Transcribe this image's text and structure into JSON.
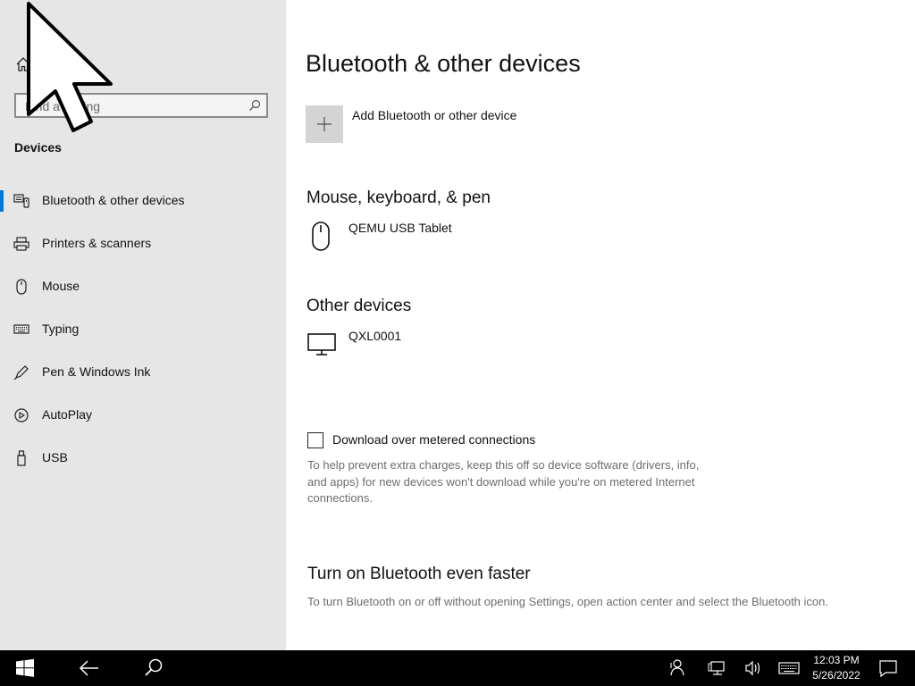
{
  "sidebar": {
    "home_icon": "home-icon",
    "search": {
      "placeholder": "Find a setting",
      "icon": "search-icon"
    },
    "section_title": "Devices",
    "items": [
      {
        "label": "Bluetooth & other devices",
        "icon": "bluetooth-devices-icon",
        "active": true
      },
      {
        "label": "Printers & scanners",
        "icon": "printer-icon"
      },
      {
        "label": "Mouse",
        "icon": "mouse-icon"
      },
      {
        "label": "Typing",
        "icon": "keyboard-icon"
      },
      {
        "label": "Pen & Windows Ink",
        "icon": "pen-icon"
      },
      {
        "label": "AutoPlay",
        "icon": "autoplay-icon"
      },
      {
        "label": "USB",
        "icon": "usb-icon"
      }
    ]
  },
  "main": {
    "title": "Bluetooth & other devices",
    "add_device_label": "Add Bluetooth or other device",
    "mouse_section": {
      "heading": "Mouse, keyboard, & pen",
      "devices": [
        {
          "name": "QEMU USB Tablet",
          "icon": "mouse-icon"
        }
      ]
    },
    "other_section": {
      "heading": "Other devices",
      "devices": [
        {
          "name": "QXL0001",
          "icon": "monitor-icon"
        }
      ]
    },
    "metered": {
      "label": "Download over metered connections",
      "checked": false,
      "help": "To help prevent extra charges, keep this off so device software (drivers, info, and apps) for new devices won't download while you're on metered Internet connections."
    },
    "faster": {
      "heading": "Turn on Bluetooth even faster",
      "description": "To turn Bluetooth on or off without opening Settings, open action center and select the Bluetooth icon."
    }
  },
  "taskbar": {
    "time": "12:03 PM",
    "date": "5/26/2022",
    "icons": [
      "windows-start-icon",
      "back-arrow-icon",
      "search-icon",
      "people-icon",
      "network-icon",
      "volume-icon",
      "touch-keyboard-icon",
      "action-center-icon"
    ]
  },
  "colors": {
    "accent": "#0078d7",
    "sidebar_bg": "#e6e6e6",
    "taskbar_bg": "#000000"
  }
}
